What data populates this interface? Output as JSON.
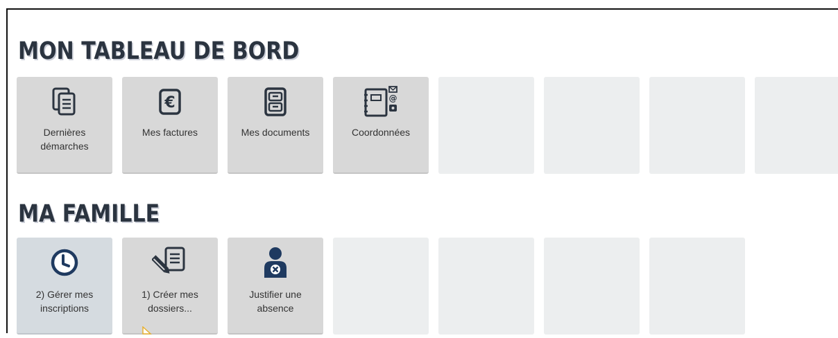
{
  "dashboard": {
    "title": "MON TABLEAU DE BORD",
    "tiles": [
      {
        "label": "Dernières démarches",
        "icon": "document-list-icon"
      },
      {
        "label": "Mes factures",
        "icon": "euro-icon"
      },
      {
        "label": "Mes documents",
        "icon": "filing-cabinet-icon"
      },
      {
        "label": "Coordonnées",
        "icon": "address-book-icon"
      }
    ]
  },
  "family": {
    "title": "MA FAMILLE",
    "tiles": [
      {
        "label": "2) Gérer mes inscriptions",
        "icon": "clock-icon"
      },
      {
        "label": "1) Créer mes dossiers...",
        "icon": "pencil-document-icon"
      },
      {
        "label": "Justifier une absence",
        "icon": "user-absence-icon"
      }
    ]
  },
  "colors": {
    "icon_dark": "#2b3440",
    "icon_blue": "#1f3a60",
    "tile_active": "#d8d8d8",
    "tile_placeholder": "#eceeef"
  }
}
